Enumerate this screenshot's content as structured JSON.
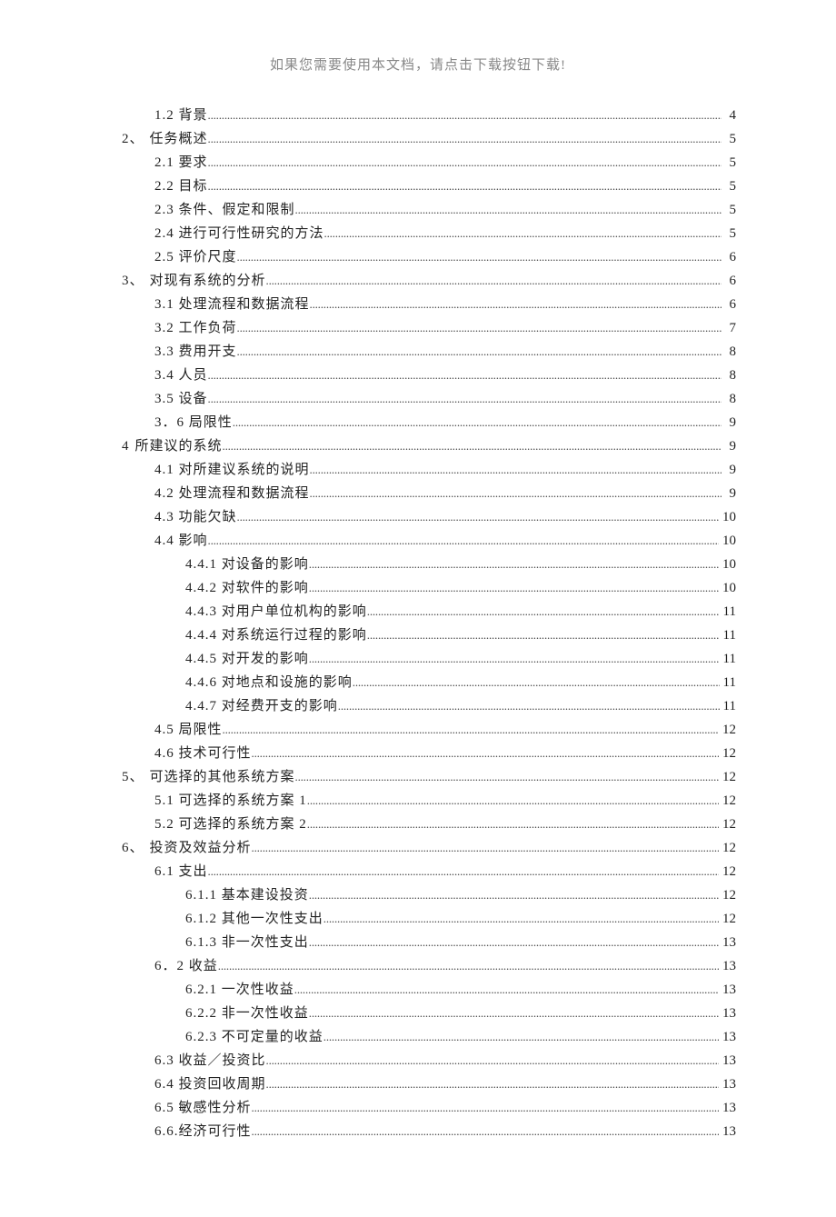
{
  "header_note": "如果您需要使用本文档，请点击下载按钮下载!",
  "toc": [
    {
      "level": 1,
      "num": "",
      "title": "1.2 背景",
      "page": "4"
    },
    {
      "level": 0,
      "num": "2、",
      "title": "任务概述",
      "page": "5"
    },
    {
      "level": 1,
      "num": "",
      "title": "2.1 要求",
      "page": "5"
    },
    {
      "level": 1,
      "num": "",
      "title": "2.2 目标",
      "page": "5"
    },
    {
      "level": 1,
      "num": "",
      "title": "2.3 条件、假定和限制",
      "page": "5"
    },
    {
      "level": 1,
      "num": "",
      "title": "2.4 进行可行性研究的方法",
      "page": "5"
    },
    {
      "level": 1,
      "num": "",
      "title": "2.5 评价尺度",
      "page": "6"
    },
    {
      "level": 0,
      "num": "3、",
      "title": "对现有系统的分析",
      "page": "6"
    },
    {
      "level": 1,
      "num": "",
      "title": "3.1 处理流程和数据流程",
      "page": "6"
    },
    {
      "level": 1,
      "num": "",
      "title": "3.2 工作负荷",
      "page": "7"
    },
    {
      "level": 1,
      "num": "",
      "title": "3.3 费用开支",
      "page": "8"
    },
    {
      "level": 1,
      "num": "",
      "title": "3.4 人员",
      "page": "8"
    },
    {
      "level": 1,
      "num": "",
      "title": "3.5 设备",
      "page": "8"
    },
    {
      "level": 1,
      "num": "",
      "title": "3．6 局限性",
      "page": "9"
    },
    {
      "level": 0,
      "num": "4",
      "title": "所建议的系统",
      "page": "9"
    },
    {
      "level": 1,
      "num": "",
      "title": "4.1 对所建议系统的说明",
      "page": "9"
    },
    {
      "level": 1,
      "num": "",
      "title": "4.2 处理流程和数据流程",
      "page": "9"
    },
    {
      "level": 1,
      "num": "",
      "title": "4.3 功能欠缺",
      "page": "10"
    },
    {
      "level": 1,
      "num": "",
      "title": "4.4 影响",
      "page": "10"
    },
    {
      "level": 2,
      "num": "",
      "title": "4.4.1 对设备的影响",
      "page": "10"
    },
    {
      "level": 2,
      "num": "",
      "title": "4.4.2 对软件的影响",
      "page": "10"
    },
    {
      "level": 2,
      "num": "",
      "title": "4.4.3 对用户单位机构的影响",
      "page": "11"
    },
    {
      "level": 2,
      "num": "",
      "title": "4.4.4 对系统运行过程的影响",
      "page": "11"
    },
    {
      "level": 2,
      "num": "",
      "title": "4.4.5 对开发的影响",
      "page": "11"
    },
    {
      "level": 2,
      "num": "",
      "title": "4.4.6 对地点和设施的影响",
      "page": "11"
    },
    {
      "level": 2,
      "num": "",
      "title": "4.4.7 对经费开支的影响",
      "page": "11"
    },
    {
      "level": 1,
      "num": "",
      "title": "4.5 局限性",
      "page": "12"
    },
    {
      "level": 1,
      "num": "",
      "title": "4.6 技术可行性",
      "page": "12"
    },
    {
      "level": 0,
      "num": "5、",
      "title": "可选择的其他系统方案",
      "page": "12"
    },
    {
      "level": 1,
      "num": "",
      "title": "5.1 可选择的系统方案 1",
      "page": "12"
    },
    {
      "level": 1,
      "num": "",
      "title": "5.2 可选择的系统方案 2",
      "page": "12"
    },
    {
      "level": 0,
      "num": "6、",
      "title": "投资及效益分析",
      "page": "12"
    },
    {
      "level": 1,
      "num": "",
      "title": "6.1 支出",
      "page": "12"
    },
    {
      "level": 2,
      "num": "",
      "title": "6.1.1 基本建设投资",
      "page": "12"
    },
    {
      "level": 2,
      "num": "",
      "title": "6.1.2 其他一次性支出",
      "page": "12"
    },
    {
      "level": 2,
      "num": "",
      "title": "6.1.3 非一次性支出",
      "page": "13"
    },
    {
      "level": 1,
      "num": "",
      "title": "6．2 收益",
      "page": "13"
    },
    {
      "level": 2,
      "num": "",
      "title": "6.2.1 一次性收益",
      "page": "13"
    },
    {
      "level": 2,
      "num": "",
      "title": "6.2.2 非一次性收益",
      "page": "13"
    },
    {
      "level": 2,
      "num": "",
      "title": "6.2.3 不可定量的收益",
      "page": "13"
    },
    {
      "level": 1,
      "num": "",
      "title": "6.3 收益／投资比",
      "page": "13"
    },
    {
      "level": 1,
      "num": "",
      "title": "6.4 投资回收周期",
      "page": "13"
    },
    {
      "level": 1,
      "num": "",
      "title": "6.5 敏感性分析",
      "page": "13"
    },
    {
      "level": 1,
      "num": "",
      "title": "6.6.经济可行性",
      "page": "13"
    }
  ]
}
